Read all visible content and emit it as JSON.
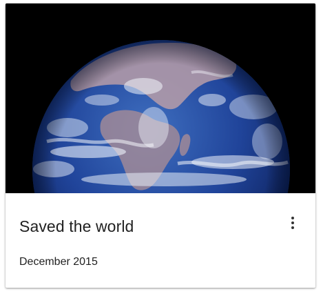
{
  "card": {
    "title": "Saved the world",
    "subtitle": "December 2015",
    "media_icon": "earth-photo",
    "menu_icon": "more-vert-icon"
  },
  "colors": {
    "media_background": "#000000",
    "card_background": "#ffffff",
    "text": "#212121",
    "icon": "#333333"
  }
}
